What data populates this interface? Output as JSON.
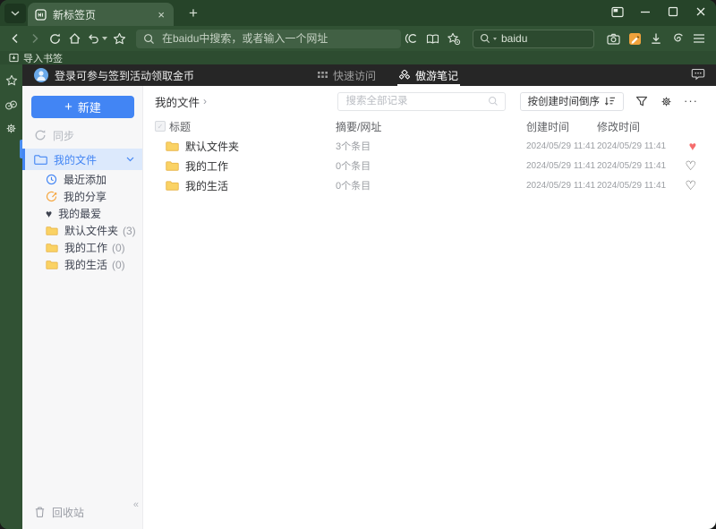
{
  "chrome": {
    "tab_title": "新标签页",
    "address_placeholder": "在baidu中搜索，或者输入一个网址",
    "quick_search_engine": "baidu",
    "import_bookmarks_label": "导入书签"
  },
  "banner": {
    "login_text": "登录可参与签到活动领取金币",
    "tab_quick_access": "快速访问",
    "tab_maxnote": "傲游笔记"
  },
  "sidebar": {
    "new_label": "新建",
    "sync_label": "同步",
    "my_files_label": "我的文件",
    "items": [
      {
        "label": "最近添加"
      },
      {
        "label": "我的分享"
      },
      {
        "label": "我的最爱"
      },
      {
        "label": "默认文件夹",
        "count": "(3)"
      },
      {
        "label": "我的工作",
        "count": "(0)"
      },
      {
        "label": "我的生活",
        "count": "(0)"
      }
    ],
    "recycle_label": "回收站",
    "collapse_glyph": "«"
  },
  "main": {
    "breadcrumb": "我的文件",
    "breadcrumb_arrow": "›",
    "search_placeholder": "搜索全部记录",
    "sort_label": "按创建时间倒序",
    "more_glyph": "···",
    "table": {
      "columns": {
        "title": "标题",
        "summary": "摘要/网址",
        "created": "创建时间",
        "modified": "修改时间"
      },
      "rows": [
        {
          "title": "默认文件夹",
          "summary": "3个条目",
          "created": "2024/05/29 11:41",
          "modified": "2024/05/29 11:41",
          "favorite": true
        },
        {
          "title": "我的工作",
          "summary": "0个条目",
          "created": "2024/05/29 11:41",
          "modified": "2024/05/29 11:41",
          "favorite": false
        },
        {
          "title": "我的生活",
          "summary": "0个条目",
          "created": "2024/05/29 11:41",
          "modified": "2024/05/29 11:41",
          "favorite": false
        }
      ]
    }
  },
  "colors": {
    "chrome_green_dark": "#264429",
    "chrome_green": "#315234",
    "chrome_green_light": "#416044",
    "banner_bg": "#262626",
    "accent_blue": "#4285f4",
    "folder_yellow": "#f8cb52",
    "heart_red": "#f56c6c",
    "note_orange": "#f0a23c"
  }
}
